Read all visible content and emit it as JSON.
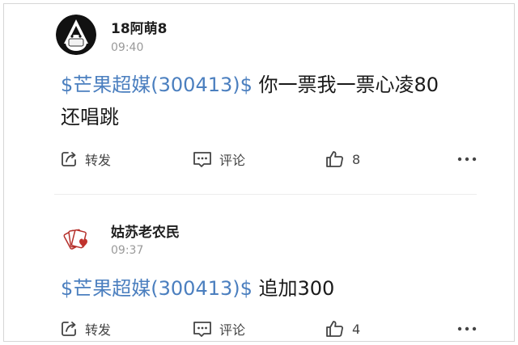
{
  "posts": [
    {
      "username": "18阿萌8",
      "time": "09:40",
      "avatar_icon": "cartoon-face-avatar",
      "stock_tag": "$芒果超媒(300413)$",
      "text_line1": " 你一票我一票心凌80",
      "text_line2": "还唱跳",
      "actions": {
        "repost_label": "转发",
        "comment_label": "评论",
        "like_count": "8"
      }
    },
    {
      "username": "姑苏老农民",
      "time": "09:37",
      "avatar_icon": "playing-cards-avatar",
      "stock_tag": "$芒果超媒(300413)$",
      "text_line1": " 追加300",
      "actions": {
        "repost_label": "转发",
        "comment_label": "评论",
        "like_count": "4"
      }
    }
  ],
  "colors": {
    "stock_link": "#4b7fbf",
    "username": "#1f1f1f",
    "timestamp": "#9a9a9a",
    "action_text": "#444444"
  }
}
